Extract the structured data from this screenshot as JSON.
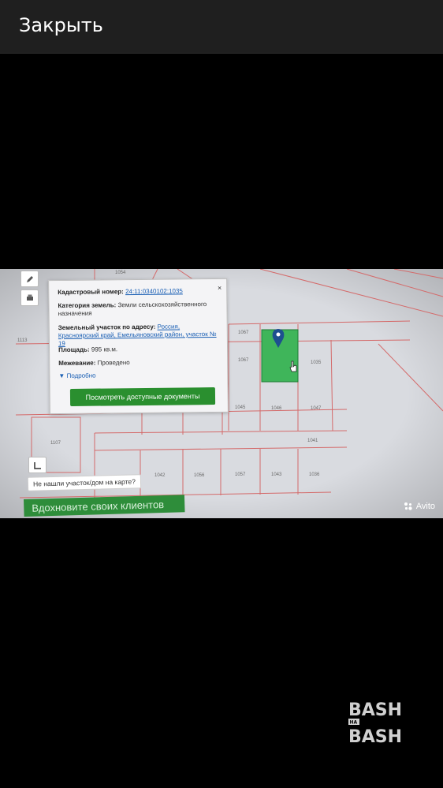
{
  "header": {
    "close_label": "Закрыть"
  },
  "map": {
    "parcels": {
      "p1054": "1054",
      "p1113": "1113",
      "p1067a": "1067",
      "p1067b": "1067",
      "p1035": "1035",
      "p1045": "1045",
      "p1046": "1046",
      "p1047": "1047",
      "p1107": "1107",
      "p1041": "1041",
      "p1042": "1042",
      "p1056": "1056",
      "p1057": "1057",
      "p1043": "1043",
      "p1036": "1036"
    }
  },
  "popup": {
    "cadastral_label": "Кадастровый номер:",
    "cadastral_value": "24:11:0340102:1035",
    "category_label": "Категория земель:",
    "category_value": "Земли сельскохозяйственного назначения",
    "address_label": "Земельный участок по адресу:",
    "address_value": "Россия, Красноярский край, Емельяновский район, участок № 19",
    "area_label": "Площадь:",
    "area_value": "995 кв.м.",
    "survey_label": "Межевание:",
    "survey_value": "Проведено",
    "more_label": "Подробно",
    "docs_button": "Посмотреть доступные документы",
    "close_glyph": "×"
  },
  "overlays": {
    "not_found": "Не нашли участок/дом на карте?",
    "banner": "Вдохновите своих клиентов",
    "avito": "Avito"
  },
  "watermark": {
    "line1": "BASH",
    "middle": "НА",
    "line2": "BASH"
  },
  "colors": {
    "selected_parcel": "#3fb55a",
    "boundary": "#d46a6a",
    "button": "#2a8f2f",
    "marker": "#1d4f8f"
  }
}
